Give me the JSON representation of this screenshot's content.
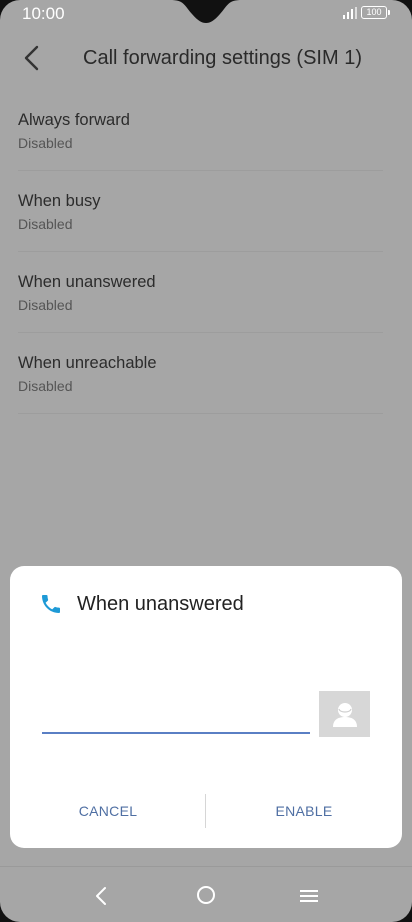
{
  "status_bar": {
    "time": "10:00",
    "battery": "100"
  },
  "header": {
    "title": "Call forwarding settings (SIM 1)"
  },
  "settings": {
    "items": [
      {
        "title": "Always forward",
        "status": "Disabled"
      },
      {
        "title": "When busy",
        "status": "Disabled"
      },
      {
        "title": "When unanswered",
        "status": "Disabled"
      },
      {
        "title": "When unreachable",
        "status": "Disabled"
      }
    ]
  },
  "dialog": {
    "title": "When unanswered",
    "number_value": "",
    "cancel_label": "CANCEL",
    "enable_label": "ENABLE",
    "icon": "phone-icon",
    "accent": "#1e9ad6"
  },
  "nav": {
    "icons": [
      "back-icon",
      "home-icon",
      "menu-icon"
    ]
  }
}
